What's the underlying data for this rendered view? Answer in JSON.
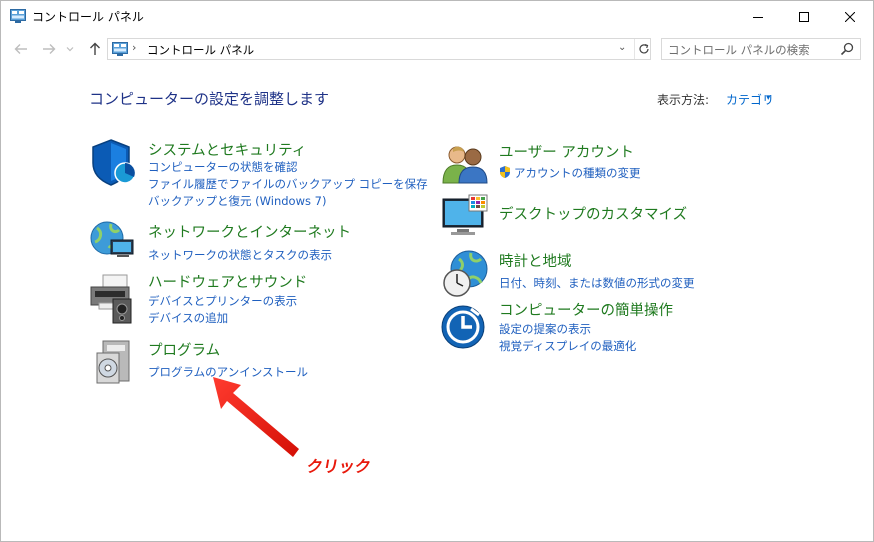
{
  "window": {
    "title": "コントロール パネル",
    "minimize_icon": "minimize-icon",
    "maximize_icon": "maximize-icon",
    "close_icon": "close-icon"
  },
  "address_bar": {
    "back_icon": "back-arrow-icon",
    "forward_icon": "forward-arrow-icon",
    "recent_icon": "chevron-down-icon",
    "up_icon": "up-arrow-icon",
    "separator": "›",
    "path": "コントロール パネル",
    "dropdown": "⌄",
    "refresh_icon": "refresh-icon"
  },
  "search": {
    "placeholder": "コントロール パネルの検索",
    "icon": "search-icon"
  },
  "main": {
    "heading": "コンピューターの設定を調整します",
    "view_by_label": "表示方法:",
    "view_by_value": "カテゴリ",
    "view_by_caret": "▾"
  },
  "categories_left": [
    {
      "title": "システムとセキュリティ",
      "icon": "shield-icon",
      "links": [
        "コンピューターの状態を確認",
        "ファイル履歴でファイルのバックアップ コピーを保存",
        "バックアップと復元 (Windows 7)"
      ]
    },
    {
      "title": "ネットワークとインターネット",
      "icon": "network-icon",
      "links": [
        "ネットワークの状態とタスクの表示"
      ]
    },
    {
      "title": "ハードウェアとサウンド",
      "icon": "printer-icon",
      "links": [
        "デバイスとプリンターの表示",
        "デバイスの追加"
      ]
    },
    {
      "title": "プログラム",
      "icon": "programs-icon",
      "links": [
        "プログラムのアンインストール"
      ]
    }
  ],
  "categories_right": [
    {
      "title": "ユーザー アカウント",
      "icon": "users-icon",
      "links": [
        "アカウントの種類の変更"
      ]
    },
    {
      "title": "デスクトップのカスタマイズ",
      "icon": "desktop-icon",
      "links": []
    },
    {
      "title": "時計と地域",
      "icon": "clock-globe-icon",
      "links": [
        "日付、時刻、または数値の形式の変更"
      ]
    },
    {
      "title": "コンピューターの簡単操作",
      "icon": "ease-of-access-icon",
      "links": [
        "設定の提案の表示",
        "視覚ディスプレイの最適化"
      ]
    }
  ],
  "annotation": {
    "label": "クリック",
    "color": "#e8190c"
  },
  "colors": {
    "category_title": "#1f7a1f",
    "link": "#1f5fbf",
    "heading": "#1e3287",
    "accent_blue": "#0066cc"
  }
}
